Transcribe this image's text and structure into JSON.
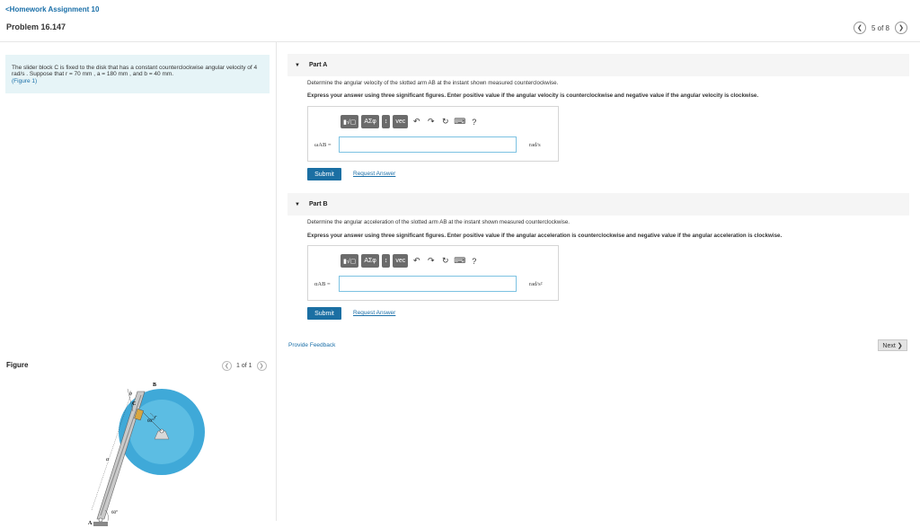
{
  "header": {
    "back_label": "<Homework Assignment 10",
    "problem_title": "Problem 16.147",
    "pager_text": "5 of 8"
  },
  "problem": {
    "text": "The slider block C is fixed to the disk that has a constant counterclockwise angular velocity of 4  rad/s . Suppose that r = 70  mm , a = 180  mm , and b = 40 mm.",
    "figure_link": "(Figure 1)"
  },
  "figure": {
    "label": "Figure",
    "pager_text": "1 of 1",
    "labels": {
      "b": "b",
      "B": "B",
      "C": "C",
      "r": "r",
      "angle60": "60°",
      "a": "a",
      "A": "A",
      "angle60b": "60°"
    }
  },
  "parts": [
    {
      "title": "Part A",
      "question": "Determine the angular velocity of the slotted arm AB at the instant shown measured counterclockwise.",
      "instruction": "Express your answer using three significant figures. Enter positive value if the angular velocity is counterclockwise and negative value if the angular velocity is clockwise.",
      "answer_label": "ωAB =",
      "unit": "rad/s",
      "submit_label": "Submit",
      "request_label": "Request Answer"
    },
    {
      "title": "Part B",
      "question": "Determine the angular acceleration of the slotted arm AB at the instant shown measured counterclockwise.",
      "instruction": "Express your answer using three significant figures. Enter positive value if the angular acceleration is counterclockwise and negative value if the angular acceleration is clockwise.",
      "answer_label": "αAB =",
      "unit": "rad/s²",
      "submit_label": "Submit",
      "request_label": "Request Answer"
    }
  ],
  "toolbar": {
    "template_label": "▮√▢",
    "greek_label": "ΑΣφ",
    "arrows_label": "↕",
    "vec_label": "vec",
    "undo_icon": "↶",
    "redo_icon": "↷",
    "reset_icon": "↻",
    "keyboard_icon": "⌨",
    "help_icon": "?"
  },
  "footer": {
    "feedback_label": "Provide Feedback",
    "next_label": "Next ❯"
  },
  "colors": {
    "link": "#1a6fa8",
    "submit": "#1b6fa3",
    "problem_bg": "#e6f4f7",
    "disk": "#3fa9d8"
  }
}
